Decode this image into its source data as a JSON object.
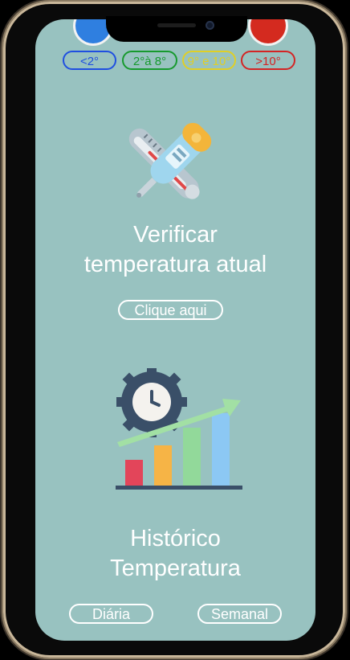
{
  "legend": {
    "items": [
      {
        "label": "<2°",
        "color": "#1f4fe0"
      },
      {
        "label": "2°à 8°",
        "color": "#179a2e"
      },
      {
        "label": "9° e 10°",
        "color": "#e0cf25"
      },
      {
        "label": ">10°",
        "color": "#d42424"
      }
    ]
  },
  "current": {
    "title_line1": "Verificar",
    "title_line2": "temperatura atual",
    "button_label": "Clique aqui",
    "icon": "thermometer-icon"
  },
  "history": {
    "title_line1": "Histórico",
    "title_line2": "Temperatura",
    "daily_label": "Diária",
    "weekly_label": "Semanal",
    "icon": "history-chart-icon"
  },
  "colors": {
    "background": "#98c2c0",
    "text": "#ffffff"
  }
}
